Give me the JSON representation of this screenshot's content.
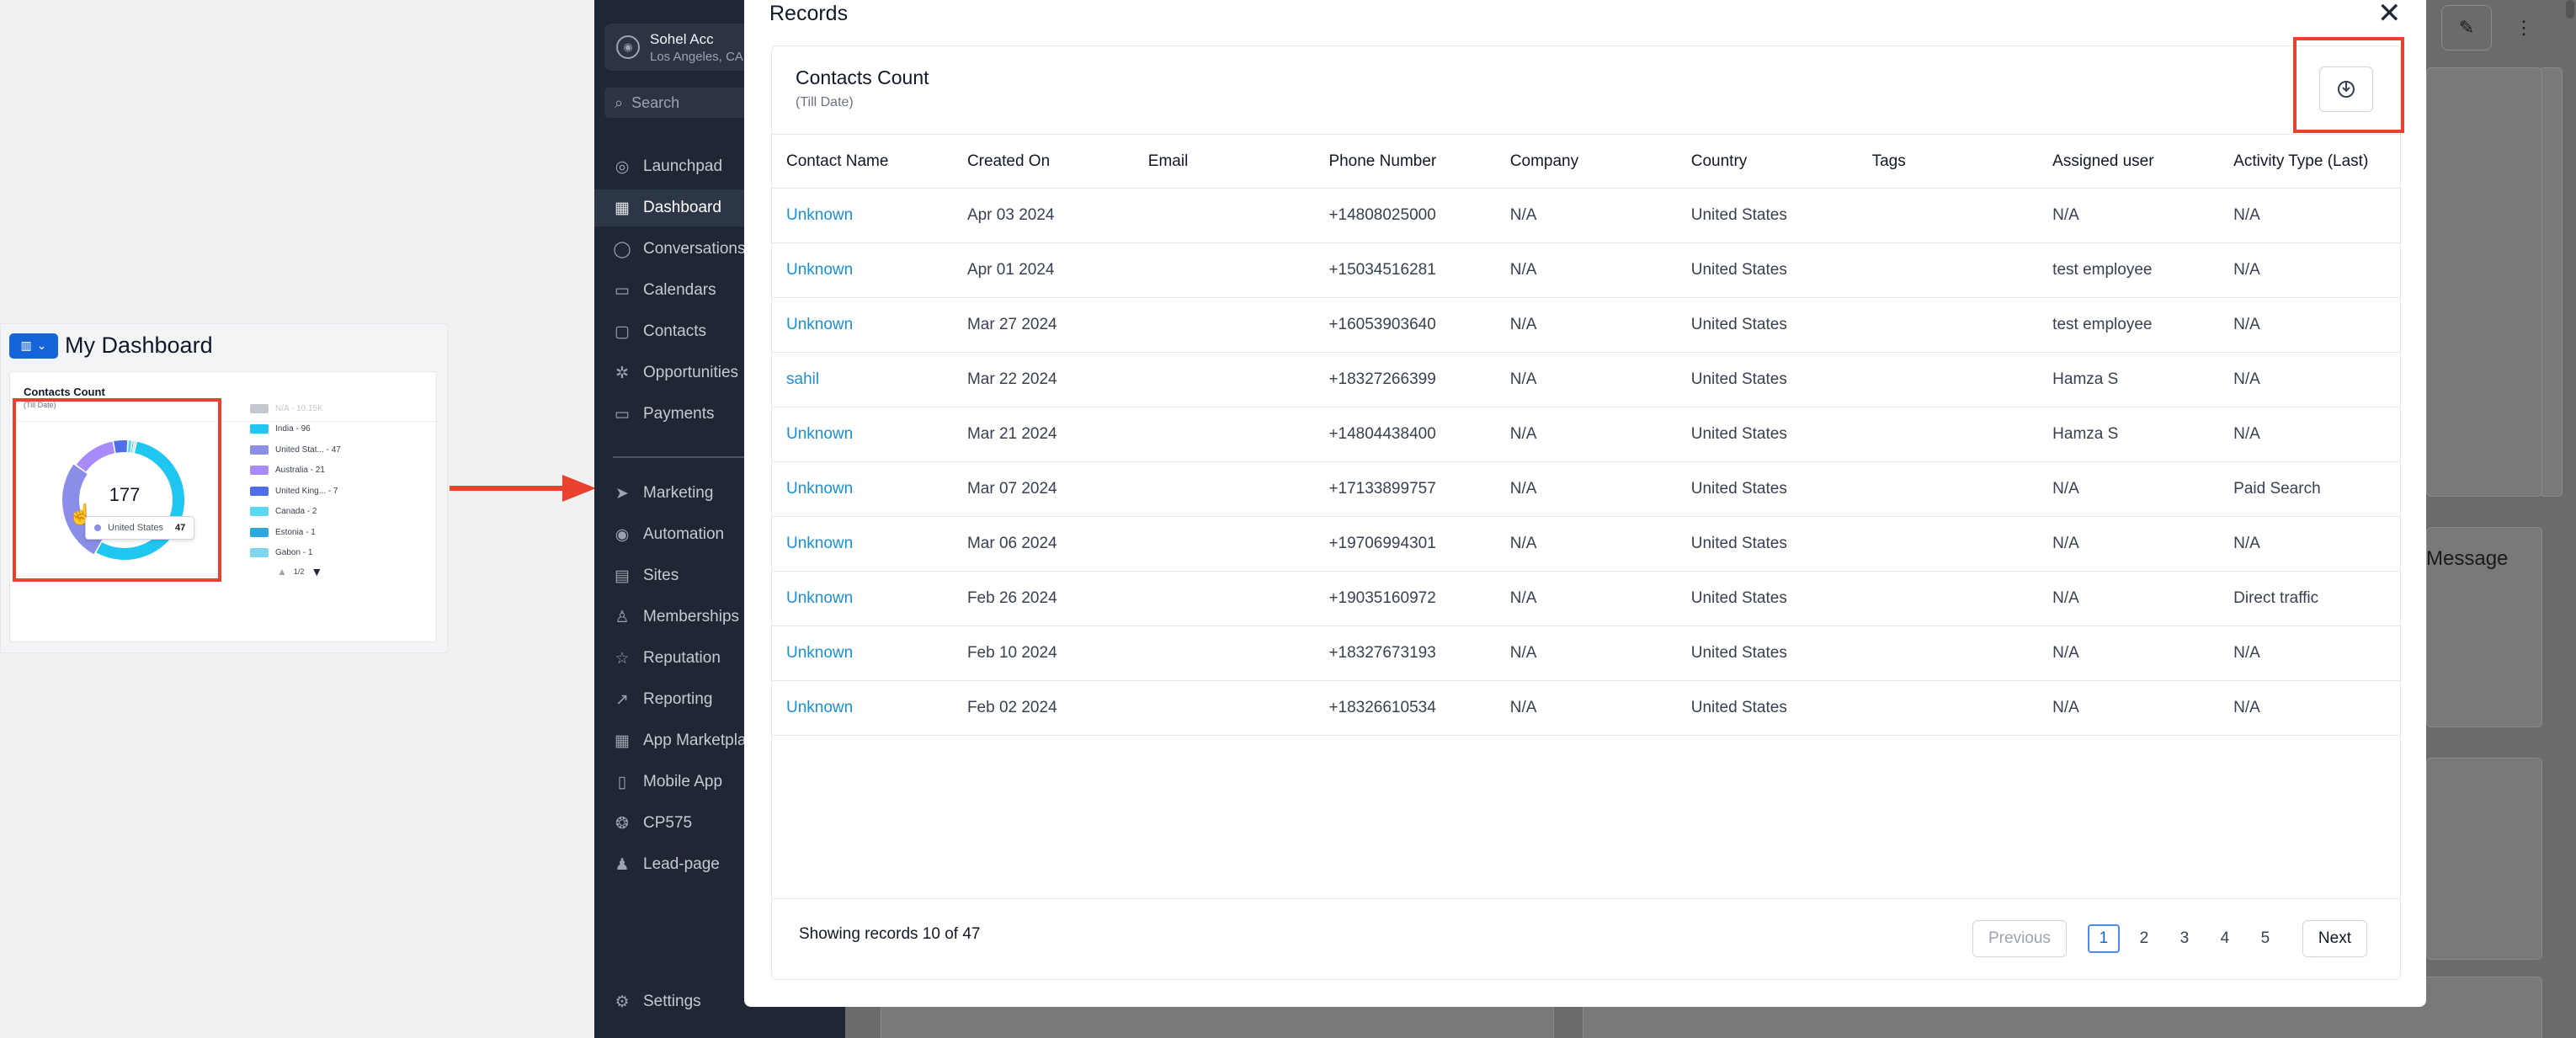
{
  "thumbnail": {
    "title": "My Dashboard",
    "card_title": "Contacts Count",
    "card_subtitle": "(Till Date)",
    "total": "177",
    "tooltip": {
      "label": "United States",
      "value": "47"
    },
    "legend": [
      {
        "label": "N/A - 10.15K",
        "color": "#c4c8cf",
        "muted": true
      },
      {
        "label": "India - 96",
        "color": "#1fc6f0"
      },
      {
        "label": "United Stat... - 47",
        "color": "#8b8ee8"
      },
      {
        "label": "Australia - 21",
        "color": "#a78bfa"
      },
      {
        "label": "United King... - 7",
        "color": "#4f6ee8"
      },
      {
        "label": "Canada - 2",
        "color": "#5ad8f0"
      },
      {
        "label": "Estonia - 1",
        "color": "#2ba8e0"
      },
      {
        "label": "Gabon - 1",
        "color": "#7fd6ee"
      }
    ],
    "legend_page": "1/2",
    "segments": [
      {
        "name": "India",
        "value": 96,
        "color": "#1fc6f0"
      },
      {
        "name": "United States",
        "value": 47,
        "color": "#8b8ee8"
      },
      {
        "name": "Australia",
        "value": 21,
        "color": "#a78bfa"
      },
      {
        "name": "United Kingdom",
        "value": 7,
        "color": "#4f6ee8"
      },
      {
        "name": "Canada",
        "value": 2,
        "color": "#5ad8f0"
      },
      {
        "name": "Estonia",
        "value": 1,
        "color": "#2ba8e0"
      },
      {
        "name": "Gabon",
        "value": 1,
        "color": "#7fd6ee"
      }
    ]
  },
  "sidebar": {
    "account_name": "Sohel Acc",
    "account_location": "Los Angeles, CA",
    "search_placeholder": "Search",
    "items": [
      {
        "label": "Launchpad",
        "icon": "rocket-icon",
        "glyph": "◎"
      },
      {
        "label": "Dashboard",
        "icon": "dashboard-icon",
        "glyph": "▦",
        "active": true
      },
      {
        "label": "Conversations",
        "icon": "chat-icon",
        "glyph": "◯"
      },
      {
        "label": "Calendars",
        "icon": "calendar-icon",
        "glyph": "▭"
      },
      {
        "label": "Contacts",
        "icon": "contacts-icon",
        "glyph": "▢"
      },
      {
        "label": "Opportunities",
        "icon": "opportunities-icon",
        "glyph": "✲"
      },
      {
        "label": "Payments",
        "icon": "payments-icon",
        "glyph": "▭"
      },
      {
        "label": "Marketing",
        "icon": "send-icon",
        "glyph": "➤"
      },
      {
        "label": "Automation",
        "icon": "automation-icon",
        "glyph": "◉"
      },
      {
        "label": "Sites",
        "icon": "sites-icon",
        "glyph": "▤"
      },
      {
        "label": "Memberships",
        "icon": "memberships-icon",
        "glyph": "♙"
      },
      {
        "label": "Reputation",
        "icon": "star-icon",
        "glyph": "☆"
      },
      {
        "label": "Reporting",
        "icon": "chart-icon",
        "glyph": "↗"
      },
      {
        "label": "App Marketplace",
        "icon": "apps-icon",
        "glyph": "▦"
      },
      {
        "label": "Mobile App",
        "icon": "phone-icon",
        "glyph": "▯"
      },
      {
        "label": "CP575",
        "icon": "wechat-icon",
        "glyph": "❂"
      },
      {
        "label": "Lead-page",
        "icon": "user-icon",
        "glyph": "♟"
      }
    ],
    "settings_label": "Settings"
  },
  "background": {
    "message_label": "Message"
  },
  "modal": {
    "title": "Records",
    "panel_title": "Contacts Count",
    "panel_subtitle": "(Till Date)",
    "columns": [
      "Contact Name",
      "Created On",
      "Email",
      "Phone Number",
      "Company",
      "Country",
      "Tags",
      "Assigned user",
      "Activity Type (Last)"
    ],
    "rows": [
      [
        "Unknown",
        "Apr 03 2024",
        "",
        "+14808025000",
        "N/A",
        "United States",
        "",
        "N/A",
        "N/A"
      ],
      [
        "Unknown",
        "Apr 01 2024",
        "",
        "+15034516281",
        "N/A",
        "United States",
        "",
        "test employee",
        "N/A"
      ],
      [
        "Unknown",
        "Mar 27 2024",
        "",
        "+16053903640",
        "N/A",
        "United States",
        "",
        "test employee",
        "N/A"
      ],
      [
        "sahil",
        "Mar 22 2024",
        "",
        "+18327266399",
        "N/A",
        "United States",
        "",
        "Hamza S",
        "N/A"
      ],
      [
        "Unknown",
        "Mar 21 2024",
        "",
        "+14804438400",
        "N/A",
        "United States",
        "",
        "Hamza S",
        "N/A"
      ],
      [
        "Unknown",
        "Mar 07 2024",
        "",
        "+17133899757",
        "N/A",
        "United States",
        "",
        "N/A",
        "Paid Search"
      ],
      [
        "Unknown",
        "Mar 06 2024",
        "",
        "+19706994301",
        "N/A",
        "United States",
        "",
        "N/A",
        "N/A"
      ],
      [
        "Unknown",
        "Feb 26 2024",
        "",
        "+19035160972",
        "N/A",
        "United States",
        "",
        "N/A",
        "Direct traffic"
      ],
      [
        "Unknown",
        "Feb 10 2024",
        "",
        "+18327673193",
        "N/A",
        "United States",
        "",
        "N/A",
        "N/A"
      ],
      [
        "Unknown",
        "Feb 02 2024",
        "",
        "+18326610534",
        "N/A",
        "United States",
        "",
        "N/A",
        "N/A"
      ]
    ],
    "showing_text": "Showing records 10 of 47",
    "pagination": {
      "previous": "Previous",
      "next": "Next",
      "pages": [
        "1",
        "2",
        "3",
        "4",
        "5"
      ],
      "current": "1"
    }
  },
  "colors": {
    "accent": "#1565d8",
    "link": "#1a8fd6",
    "highlight": "#e8422f",
    "sidebar_bg": "#1f2735"
  }
}
